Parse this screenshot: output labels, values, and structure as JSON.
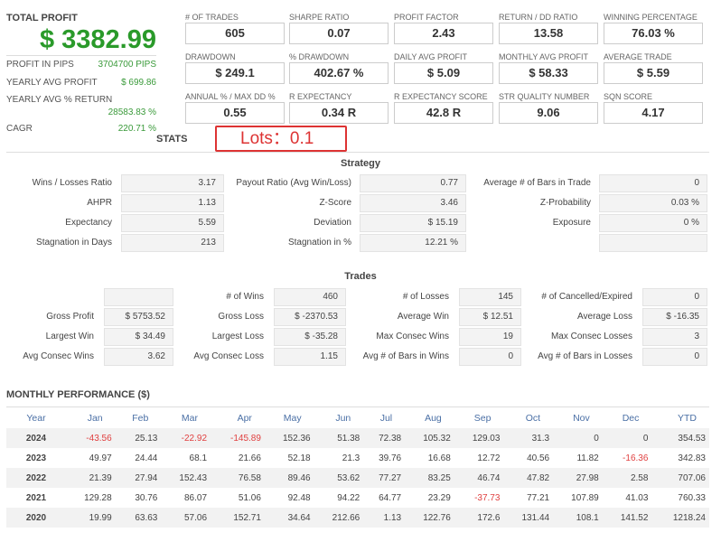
{
  "summary": {
    "total_profit_label": "TOTAL PROFIT",
    "total_profit": "$ 3382.99",
    "rows": [
      {
        "label": "PROFIT IN PIPS",
        "value": "3704700 PIPS"
      },
      {
        "label": "YEARLY AVG PROFIT",
        "value": "$ 699.86"
      },
      {
        "label": "YEARLY AVG % RETURN",
        "value": "28583.83 %"
      },
      {
        "label": "CAGR",
        "value": "220.71 %"
      }
    ]
  },
  "cards": [
    {
      "label": "# OF TRADES",
      "value": "605"
    },
    {
      "label": "SHARPE RATIO",
      "value": "0.07"
    },
    {
      "label": "PROFIT FACTOR",
      "value": "2.43"
    },
    {
      "label": "RETURN / DD RATIO",
      "value": "13.58"
    },
    {
      "label": "WINNING PERCENTAGE",
      "value": "76.03 %"
    },
    {
      "label": "DRAWDOWN",
      "value": "$ 249.1"
    },
    {
      "label": "% DRAWDOWN",
      "value": "402.67 %"
    },
    {
      "label": "DAILY AVG PROFIT",
      "value": "$ 5.09"
    },
    {
      "label": "MONTHLY AVG PROFIT",
      "value": "$ 58.33"
    },
    {
      "label": "AVERAGE TRADE",
      "value": "$ 5.59"
    },
    {
      "label": "ANNUAL % / MAX DD %",
      "value": "0.55"
    },
    {
      "label": "R EXPECTANCY",
      "value": "0.34 R"
    },
    {
      "label": "R EXPECTANCY SCORE",
      "value": "42.8 R"
    },
    {
      "label": "STR QUALITY NUMBER",
      "value": "9.06"
    },
    {
      "label": "SQN SCORE",
      "value": "4.17"
    }
  ],
  "stats_title": "STATS",
  "annotation": "Lots：0.1",
  "strategy": {
    "title": "Strategy",
    "rows": [
      [
        {
          "label": "Wins / Losses Ratio",
          "value": "3.17"
        },
        {
          "label": "Payout Ratio (Avg Win/Loss)",
          "value": "0.77"
        },
        {
          "label": "Average # of Bars in Trade",
          "value": "0"
        }
      ],
      [
        {
          "label": "AHPR",
          "value": "1.13"
        },
        {
          "label": "Z-Score",
          "value": "3.46"
        },
        {
          "label": "Z-Probability",
          "value": "0.03 %"
        }
      ],
      [
        {
          "label": "Expectancy",
          "value": "5.59"
        },
        {
          "label": "Deviation",
          "value": "$ 15.19"
        },
        {
          "label": "Exposure",
          "value": "0 %"
        }
      ],
      [
        {
          "label": "Stagnation in Days",
          "value": "213"
        },
        {
          "label": "Stagnation in %",
          "value": "12.21 %"
        },
        {
          "label": "",
          "value": ""
        }
      ]
    ]
  },
  "trades": {
    "title": "Trades",
    "rows": [
      [
        {
          "label": "",
          "value": ""
        },
        {
          "label": "# of Wins",
          "value": "460"
        },
        {
          "label": "# of Losses",
          "value": "145"
        },
        {
          "label": "# of Cancelled/Expired",
          "value": "0"
        }
      ],
      [
        {
          "label": "Gross Profit",
          "value": "$ 5753.52"
        },
        {
          "label": "Gross Loss",
          "value": "$ -2370.53"
        },
        {
          "label": "Average Win",
          "value": "$ 12.51"
        },
        {
          "label": "Average Loss",
          "value": "$ -16.35"
        }
      ],
      [
        {
          "label": "Largest Win",
          "value": "$ 34.49"
        },
        {
          "label": "Largest Loss",
          "value": "$ -35.28"
        },
        {
          "label": "Max Consec Wins",
          "value": "19"
        },
        {
          "label": "Max Consec Losses",
          "value": "3"
        }
      ],
      [
        {
          "label": "Avg Consec Wins",
          "value": "3.62"
        },
        {
          "label": "Avg Consec Loss",
          "value": "1.15"
        },
        {
          "label": "Avg # of Bars in Wins",
          "value": "0"
        },
        {
          "label": "Avg # of Bars in Losses",
          "value": "0"
        }
      ]
    ]
  },
  "monthly": {
    "title": "MONTHLY PERFORMANCE ($)",
    "headers": [
      "Year",
      "Jan",
      "Feb",
      "Mar",
      "Apr",
      "May",
      "Jun",
      "Jul",
      "Aug",
      "Sep",
      "Oct",
      "Nov",
      "Dec",
      "YTD"
    ],
    "rows": [
      [
        "2024",
        "-43.56",
        "25.13",
        "-22.92",
        "-145.89",
        "152.36",
        "51.38",
        "72.38",
        "105.32",
        "129.03",
        "31.3",
        "0",
        "0",
        "354.53"
      ],
      [
        "2023",
        "49.97",
        "24.44",
        "68.1",
        "21.66",
        "52.18",
        "21.3",
        "39.76",
        "16.68",
        "12.72",
        "40.56",
        "11.82",
        "-16.36",
        "342.83"
      ],
      [
        "2022",
        "21.39",
        "27.94",
        "152.43",
        "76.58",
        "89.46",
        "53.62",
        "77.27",
        "83.25",
        "46.74",
        "47.82",
        "27.98",
        "2.58",
        "707.06"
      ],
      [
        "2021",
        "129.28",
        "30.76",
        "86.07",
        "51.06",
        "92.48",
        "94.22",
        "64.77",
        "23.29",
        "-37.73",
        "77.21",
        "107.89",
        "41.03",
        "760.33"
      ],
      [
        "2020",
        "19.99",
        "63.63",
        "57.06",
        "152.71",
        "34.64",
        "212.66",
        "1.13",
        "122.76",
        "172.6",
        "131.44",
        "108.1",
        "141.52",
        "1218.24"
      ]
    ]
  },
  "colors": {
    "profit_green": "#2a9a2a",
    "negative_red": "#e04040",
    "header_blue": "#4a6fa5",
    "annotation_red": "#dd3333"
  }
}
